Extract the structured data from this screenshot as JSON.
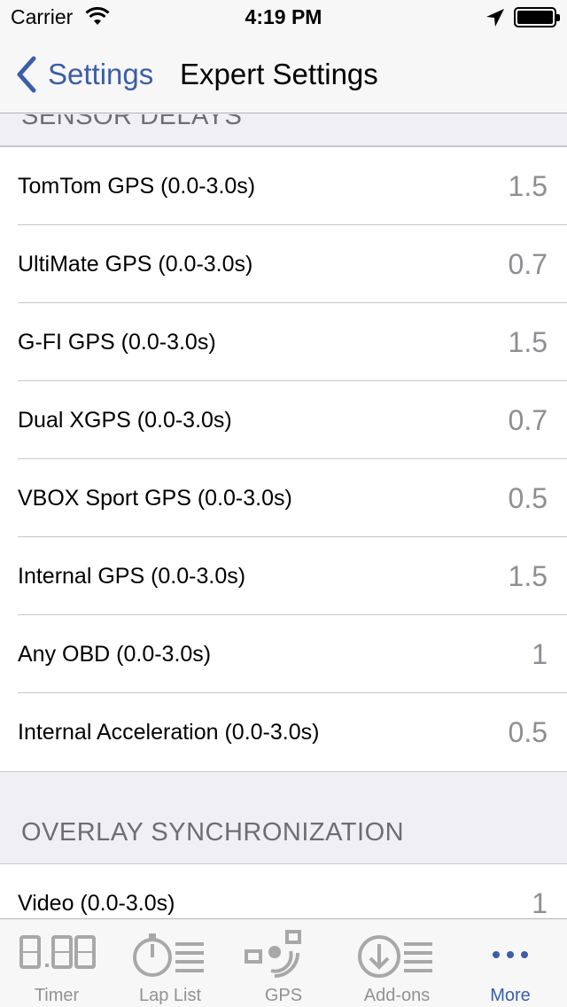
{
  "status_bar": {
    "carrier": "Carrier",
    "time": "4:19 PM"
  },
  "nav": {
    "back_label": "Settings",
    "title": "Expert Settings"
  },
  "sections": {
    "sensor_delays_header": "SENSOR DELAYS",
    "sensor_delays": [
      {
        "label": "TomTom GPS (0.0-3.0s)",
        "value": "1.5"
      },
      {
        "label": "UltiMate GPS (0.0-3.0s)",
        "value": "0.7"
      },
      {
        "label": "G-FI GPS (0.0-3.0s)",
        "value": "1.5"
      },
      {
        "label": "Dual XGPS (0.0-3.0s)",
        "value": "0.7"
      },
      {
        "label": "VBOX Sport GPS (0.0-3.0s)",
        "value": "0.5"
      },
      {
        "label": "Internal GPS (0.0-3.0s)",
        "value": "1.5"
      },
      {
        "label": "Any OBD (0.0-3.0s)",
        "value": "1"
      },
      {
        "label": "Internal Acceleration (0.0-3.0s)",
        "value": "0.5"
      }
    ],
    "overlay_header": "OVERLAY SYNCHRONIZATION",
    "overlay": [
      {
        "label": "Video (0.0-3.0s)",
        "value": "1"
      }
    ]
  },
  "tab_bar": {
    "tabs": [
      {
        "label": "Timer",
        "icon": "timer-digits-icon"
      },
      {
        "label": "Lap List",
        "icon": "lap-list-icon"
      },
      {
        "label": "GPS",
        "icon": "gps-signal-icon"
      },
      {
        "label": "Add-ons",
        "icon": "add-ons-download-icon"
      },
      {
        "label": "More",
        "icon": "more-dots-icon"
      }
    ],
    "active": "More"
  },
  "colors": {
    "accent": "#3b5ea6",
    "value_gray": "#8e8e93",
    "header_gray": "#6d6d72",
    "tab_gray": "#929292"
  }
}
